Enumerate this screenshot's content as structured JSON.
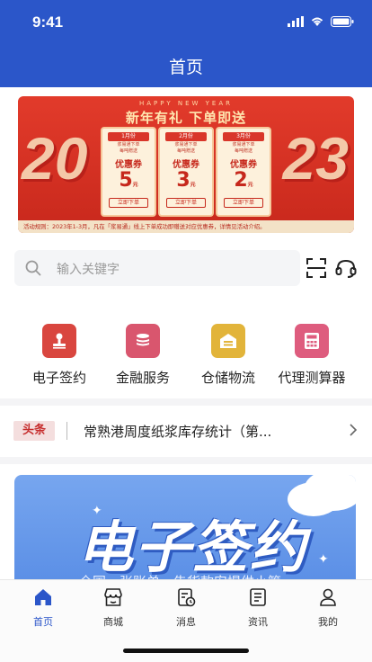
{
  "status_bar": {
    "time": "9:41"
  },
  "header": {
    "title": "首页"
  },
  "banner": {
    "subtitle": "HAPPY NEW YEAR",
    "title": "新年有礼  下单即送",
    "year_left": "20",
    "year_right": "23",
    "coupons": [
      {
        "month": "1月份",
        "desc1": "浆易通下单",
        "desc2": "每吨赠送",
        "type": "优惠券",
        "amount": "5",
        "unit": "元",
        "button": "立即下单"
      },
      {
        "month": "2月份",
        "desc1": "浆易通下单",
        "desc2": "每吨赠送",
        "type": "优惠券",
        "amount": "3",
        "unit": "元",
        "button": "立即下单"
      },
      {
        "month": "3月份",
        "desc1": "浆易通下单",
        "desc2": "每吨赠送",
        "type": "优惠券",
        "amount": "2",
        "unit": "元",
        "button": "立即下单"
      }
    ],
    "rules": "活动规则：2023年1-3月，凡在「浆易通」线上下单成功即赠送对应优惠券，详情见活动介绍。"
  },
  "search": {
    "placeholder": "输入关键字"
  },
  "actions": [
    {
      "label": "电子签约",
      "color": "#d9463f"
    },
    {
      "label": "金融服务",
      "color": "#d9566e"
    },
    {
      "label": "仓储物流",
      "color": "#e2b43a"
    },
    {
      "label": "代理测算器",
      "color": "#de5c7e"
    }
  ],
  "news": {
    "tag": "头条",
    "text": "常熟港周度纸浆库存统计（第..."
  },
  "promo": {
    "title": "电子签约",
    "subtitle": "全国一张账单，告货款安提供小管"
  },
  "tabbar": {
    "items": [
      {
        "label": "首页",
        "active": true
      },
      {
        "label": "商城"
      },
      {
        "label": "消息"
      },
      {
        "label": "资讯"
      },
      {
        "label": "我的"
      }
    ]
  },
  "colors": {
    "primary": "#2b56c9",
    "banner_red": "#e23b2b"
  }
}
